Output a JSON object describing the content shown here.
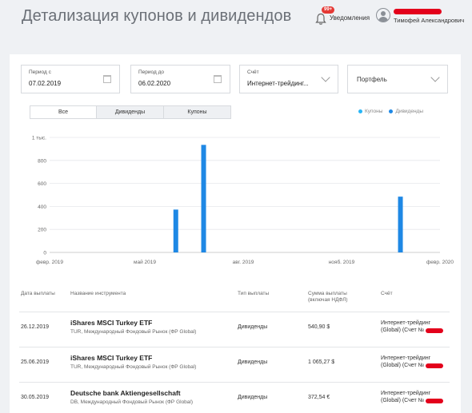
{
  "page": {
    "title": "Детализация купонов и дивидендов"
  },
  "header": {
    "notif_badge": "99+",
    "notif_label": "Уведомления",
    "user_name": "Тимофей Александрович"
  },
  "filters": {
    "period_from": {
      "label": "Период с",
      "value": "07.02.2019"
    },
    "period_to": {
      "label": "Период до",
      "value": "06.02.2020"
    },
    "account": {
      "label": "Счёт",
      "value": "Интернет-трейдинг..."
    },
    "portfolio": {
      "placeholder": "Портфель"
    }
  },
  "tabs": [
    {
      "label": "Все",
      "active": true
    },
    {
      "label": "Дивиденды",
      "active": false
    },
    {
      "label": "Купоны",
      "active": false
    }
  ],
  "legend": [
    {
      "label": "Купоны",
      "color": "#29b6f6"
    },
    {
      "label": "Дивиденды",
      "color": "#1e88e5"
    }
  ],
  "chart_data": {
    "type": "bar",
    "y_ticks": [
      "0",
      "200",
      "400",
      "600",
      "800",
      "1 тыс."
    ],
    "ylim": [
      0,
      1000
    ],
    "x_ticks": [
      "февр. 2019",
      "май 2019",
      "авг. 2019",
      "нояб. 2019",
      "февр. 2020"
    ],
    "x_tick_dates": [
      "2019-02-01",
      "2019-05-01",
      "2019-08-01",
      "2019-11-01",
      "2020-02-01"
    ],
    "xlim": [
      "2019-02-01",
      "2020-02-01"
    ],
    "series": [
      {
        "name": "Дивиденды",
        "color": "#1e88e5",
        "points": [
          {
            "date": "2019-05-30",
            "value": 372.54
          },
          {
            "date": "2019-06-25",
            "value": 935
          },
          {
            "date": "2019-12-26",
            "value": 485
          }
        ]
      }
    ]
  },
  "table": {
    "headers": {
      "date": "Дата выплаты",
      "instrument": "Название инструмента",
      "type": "Тип выплаты",
      "amount_line1": "Сумма выплаты",
      "amount_line2": "(включая НДФЛ)",
      "account": "Счёт"
    },
    "rows": [
      {
        "date": "26.12.2019",
        "name": "iShares MSCI Turkey ETF",
        "sub": "TUR, Международный Фондовый Рынок (ФР Global)",
        "type": "Дивиденды",
        "amount": "540,90 $",
        "account1": "Интернет-трейдинг",
        "account2": "(Global) (Счет №"
      },
      {
        "date": "25.06.2019",
        "name": "iShares MSCI Turkey ETF",
        "sub": "TUR, Международный Фондовый Рынок (ФР Global)",
        "type": "Дивиденды",
        "amount": "1 065,27 $",
        "account1": "Интернет-трейдинг",
        "account2": "(Global) (Счет №"
      },
      {
        "date": "30.05.2019",
        "name": "Deutsche bank Aktiengesellschaft",
        "sub": "DB, Международный Фондовый Рынок (ФР Global)",
        "type": "Дивиденды",
        "amount": "372,54 €",
        "account1": "Интернет-трейдинг",
        "account2": "(Global) (Счет №"
      }
    ]
  }
}
